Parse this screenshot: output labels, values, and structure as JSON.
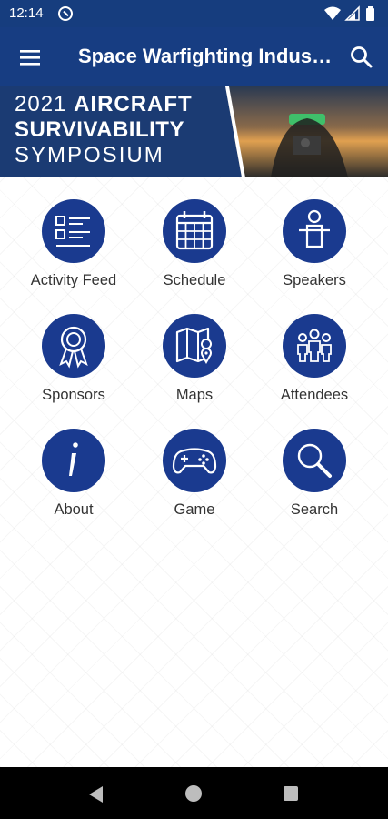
{
  "status_bar": {
    "time": "12:14",
    "icons": [
      "app-notification-icon",
      "wifi-icon",
      "signal-icon",
      "battery-icon"
    ]
  },
  "app_bar": {
    "title": "Space Warfighting Industry Forum",
    "menu_icon": "hamburger-menu-icon",
    "search_icon": "search-icon"
  },
  "banner": {
    "year": "2021",
    "line1": "AIRCRAFT",
    "line2": "SURVIVABILITY",
    "line3": "SYMPOSIUM"
  },
  "tiles": [
    {
      "label": "Activity Feed",
      "icon": "activity-feed-icon"
    },
    {
      "label": "Schedule",
      "icon": "calendar-icon"
    },
    {
      "label": "Speakers",
      "icon": "speaker-podium-icon"
    },
    {
      "label": "Sponsors",
      "icon": "award-ribbon-icon"
    },
    {
      "label": "Maps",
      "icon": "map-icon"
    },
    {
      "label": "Attendees",
      "icon": "people-icon"
    },
    {
      "label": "About",
      "icon": "info-icon"
    },
    {
      "label": "Game",
      "icon": "gamepad-icon"
    },
    {
      "label": "Search",
      "icon": "magnifier-icon"
    }
  ],
  "nav_bar": {
    "back": "back-icon",
    "home": "home-icon",
    "recents": "recents-icon"
  },
  "colors": {
    "primary": "#173d82",
    "icon_circle": "#1a3a8f",
    "nav_bar": "#000000"
  }
}
